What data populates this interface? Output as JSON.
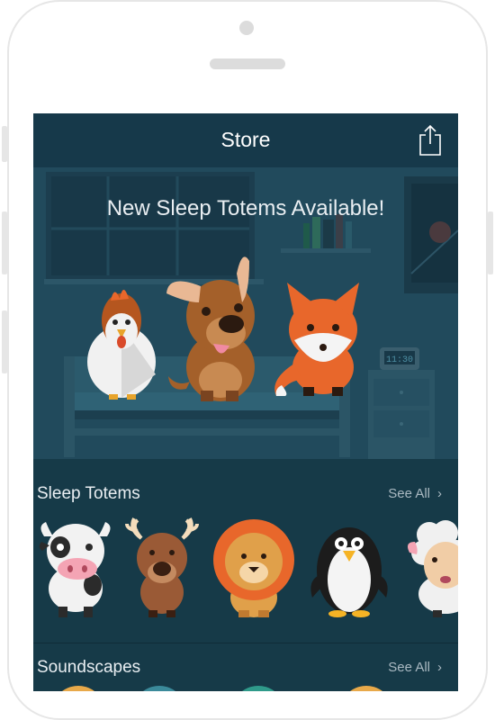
{
  "navbar": {
    "title": "Store",
    "share_icon": "share-icon"
  },
  "hero": {
    "title": "New Sleep Totems Available!",
    "clock_time": "11:30"
  },
  "sections": [
    {
      "title": "Sleep Totems",
      "see_all": "See All"
    },
    {
      "title": "Soundscapes",
      "see_all": "See All"
    }
  ],
  "totems": [
    "cow",
    "deer",
    "lion",
    "penguin",
    "sheep"
  ],
  "colors": {
    "screen_bg": "#163a48",
    "hero_bg": "#214a5c",
    "accent_orange": "#e8672b"
  }
}
